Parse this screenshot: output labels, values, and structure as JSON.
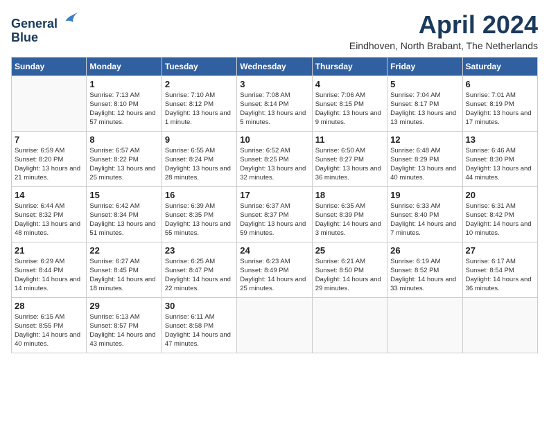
{
  "header": {
    "logo_line1": "General",
    "logo_line2": "Blue",
    "month_year": "April 2024",
    "location": "Eindhoven, North Brabant, The Netherlands"
  },
  "weekdays": [
    "Sunday",
    "Monday",
    "Tuesday",
    "Wednesday",
    "Thursday",
    "Friday",
    "Saturday"
  ],
  "weeks": [
    [
      {
        "day": "",
        "sunrise": "",
        "sunset": "",
        "daylight": ""
      },
      {
        "day": "1",
        "sunrise": "Sunrise: 7:13 AM",
        "sunset": "Sunset: 8:10 PM",
        "daylight": "Daylight: 12 hours and 57 minutes."
      },
      {
        "day": "2",
        "sunrise": "Sunrise: 7:10 AM",
        "sunset": "Sunset: 8:12 PM",
        "daylight": "Daylight: 13 hours and 1 minute."
      },
      {
        "day": "3",
        "sunrise": "Sunrise: 7:08 AM",
        "sunset": "Sunset: 8:14 PM",
        "daylight": "Daylight: 13 hours and 5 minutes."
      },
      {
        "day": "4",
        "sunrise": "Sunrise: 7:06 AM",
        "sunset": "Sunset: 8:15 PM",
        "daylight": "Daylight: 13 hours and 9 minutes."
      },
      {
        "day": "5",
        "sunrise": "Sunrise: 7:04 AM",
        "sunset": "Sunset: 8:17 PM",
        "daylight": "Daylight: 13 hours and 13 minutes."
      },
      {
        "day": "6",
        "sunrise": "Sunrise: 7:01 AM",
        "sunset": "Sunset: 8:19 PM",
        "daylight": "Daylight: 13 hours and 17 minutes."
      }
    ],
    [
      {
        "day": "7",
        "sunrise": "Sunrise: 6:59 AM",
        "sunset": "Sunset: 8:20 PM",
        "daylight": "Daylight: 13 hours and 21 minutes."
      },
      {
        "day": "8",
        "sunrise": "Sunrise: 6:57 AM",
        "sunset": "Sunset: 8:22 PM",
        "daylight": "Daylight: 13 hours and 25 minutes."
      },
      {
        "day": "9",
        "sunrise": "Sunrise: 6:55 AM",
        "sunset": "Sunset: 8:24 PM",
        "daylight": "Daylight: 13 hours and 28 minutes."
      },
      {
        "day": "10",
        "sunrise": "Sunrise: 6:52 AM",
        "sunset": "Sunset: 8:25 PM",
        "daylight": "Daylight: 13 hours and 32 minutes."
      },
      {
        "day": "11",
        "sunrise": "Sunrise: 6:50 AM",
        "sunset": "Sunset: 8:27 PM",
        "daylight": "Daylight: 13 hours and 36 minutes."
      },
      {
        "day": "12",
        "sunrise": "Sunrise: 6:48 AM",
        "sunset": "Sunset: 8:29 PM",
        "daylight": "Daylight: 13 hours and 40 minutes."
      },
      {
        "day": "13",
        "sunrise": "Sunrise: 6:46 AM",
        "sunset": "Sunset: 8:30 PM",
        "daylight": "Daylight: 13 hours and 44 minutes."
      }
    ],
    [
      {
        "day": "14",
        "sunrise": "Sunrise: 6:44 AM",
        "sunset": "Sunset: 8:32 PM",
        "daylight": "Daylight: 13 hours and 48 minutes."
      },
      {
        "day": "15",
        "sunrise": "Sunrise: 6:42 AM",
        "sunset": "Sunset: 8:34 PM",
        "daylight": "Daylight: 13 hours and 51 minutes."
      },
      {
        "day": "16",
        "sunrise": "Sunrise: 6:39 AM",
        "sunset": "Sunset: 8:35 PM",
        "daylight": "Daylight: 13 hours and 55 minutes."
      },
      {
        "day": "17",
        "sunrise": "Sunrise: 6:37 AM",
        "sunset": "Sunset: 8:37 PM",
        "daylight": "Daylight: 13 hours and 59 minutes."
      },
      {
        "day": "18",
        "sunrise": "Sunrise: 6:35 AM",
        "sunset": "Sunset: 8:39 PM",
        "daylight": "Daylight: 14 hours and 3 minutes."
      },
      {
        "day": "19",
        "sunrise": "Sunrise: 6:33 AM",
        "sunset": "Sunset: 8:40 PM",
        "daylight": "Daylight: 14 hours and 7 minutes."
      },
      {
        "day": "20",
        "sunrise": "Sunrise: 6:31 AM",
        "sunset": "Sunset: 8:42 PM",
        "daylight": "Daylight: 14 hours and 10 minutes."
      }
    ],
    [
      {
        "day": "21",
        "sunrise": "Sunrise: 6:29 AM",
        "sunset": "Sunset: 8:44 PM",
        "daylight": "Daylight: 14 hours and 14 minutes."
      },
      {
        "day": "22",
        "sunrise": "Sunrise: 6:27 AM",
        "sunset": "Sunset: 8:45 PM",
        "daylight": "Daylight: 14 hours and 18 minutes."
      },
      {
        "day": "23",
        "sunrise": "Sunrise: 6:25 AM",
        "sunset": "Sunset: 8:47 PM",
        "daylight": "Daylight: 14 hours and 22 minutes."
      },
      {
        "day": "24",
        "sunrise": "Sunrise: 6:23 AM",
        "sunset": "Sunset: 8:49 PM",
        "daylight": "Daylight: 14 hours and 25 minutes."
      },
      {
        "day": "25",
        "sunrise": "Sunrise: 6:21 AM",
        "sunset": "Sunset: 8:50 PM",
        "daylight": "Daylight: 14 hours and 29 minutes."
      },
      {
        "day": "26",
        "sunrise": "Sunrise: 6:19 AM",
        "sunset": "Sunset: 8:52 PM",
        "daylight": "Daylight: 14 hours and 33 minutes."
      },
      {
        "day": "27",
        "sunrise": "Sunrise: 6:17 AM",
        "sunset": "Sunset: 8:54 PM",
        "daylight": "Daylight: 14 hours and 36 minutes."
      }
    ],
    [
      {
        "day": "28",
        "sunrise": "Sunrise: 6:15 AM",
        "sunset": "Sunset: 8:55 PM",
        "daylight": "Daylight: 14 hours and 40 minutes."
      },
      {
        "day": "29",
        "sunrise": "Sunrise: 6:13 AM",
        "sunset": "Sunset: 8:57 PM",
        "daylight": "Daylight: 14 hours and 43 minutes."
      },
      {
        "day": "30",
        "sunrise": "Sunrise: 6:11 AM",
        "sunset": "Sunset: 8:58 PM",
        "daylight": "Daylight: 14 hours and 47 minutes."
      },
      {
        "day": "",
        "sunrise": "",
        "sunset": "",
        "daylight": ""
      },
      {
        "day": "",
        "sunrise": "",
        "sunset": "",
        "daylight": ""
      },
      {
        "day": "",
        "sunrise": "",
        "sunset": "",
        "daylight": ""
      },
      {
        "day": "",
        "sunrise": "",
        "sunset": "",
        "daylight": ""
      }
    ]
  ]
}
